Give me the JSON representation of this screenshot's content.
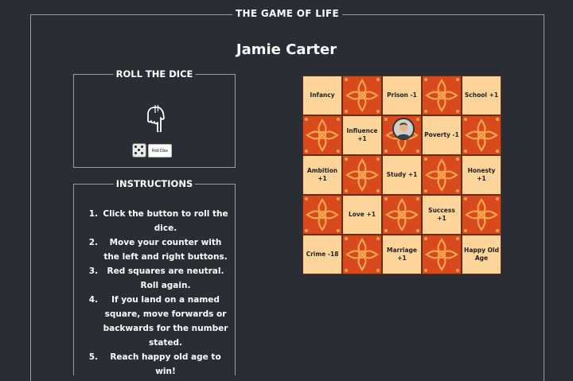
{
  "page": {
    "title": "THE GAME OF LIFE",
    "player_name": "Jamie Carter"
  },
  "dice_panel": {
    "heading": "ROLL THE DICE",
    "roll_button_label": "Roll Dice"
  },
  "instructions": {
    "heading": "INSTRUCTIONS",
    "steps": [
      {
        "num": "1.",
        "text": "Click the button to roll the dice."
      },
      {
        "num": "2.",
        "text": "Move your counter with the left and right buttons."
      },
      {
        "num": "3.",
        "text": "Red squares are neutral. Roll again."
      },
      {
        "num": "4.",
        "text": "If you land on a named square, move forwards or backwards for the number stated."
      },
      {
        "num": "5.",
        "text": "Reach happy old age to win!"
      }
    ]
  },
  "board": {
    "rows": [
      [
        "Infancy",
        "",
        "Prison -1",
        "",
        "School +1"
      ],
      [
        "",
        "Influence +1",
        "",
        "Poverty -1",
        ""
      ],
      [
        "Ambition +1",
        "",
        "Study +1",
        "",
        "Honesty +1"
      ],
      [
        "",
        "Love +1",
        "",
        "Success +1",
        ""
      ],
      [
        "Crime -18",
        "",
        "Marriage +1",
        "",
        "Happy Old Age"
      ]
    ]
  },
  "colors": {
    "background": "#2a2d34",
    "named_square": "#fdd59a",
    "neutral_square": "#d84a1e",
    "neutral_pattern": "#f6a64e"
  },
  "icons": {
    "pointer": "pointing-hand-icon",
    "die": "dice-icon",
    "counter": "player-counter-avatar"
  }
}
